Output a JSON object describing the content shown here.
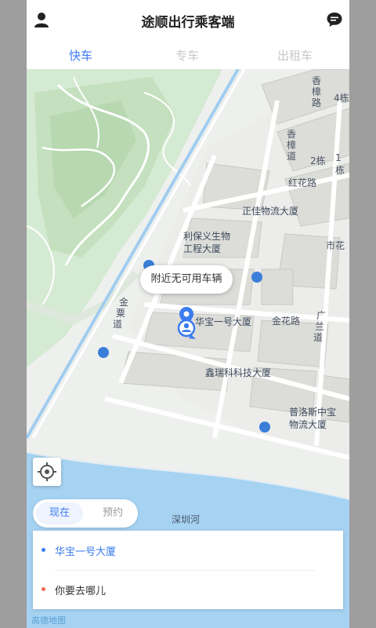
{
  "header": {
    "title": "途顺出行乘客端",
    "user_icon": "user-icon",
    "message_icon": "message-icon"
  },
  "tabs": [
    {
      "label": "快车",
      "active": true
    },
    {
      "label": "专车",
      "active": false
    },
    {
      "label": "出租车",
      "active": false
    }
  ],
  "map": {
    "bubble_text": "附近无可用车辆",
    "labels": {
      "zhengjia": "正佳物流大厦",
      "libaoyi_line1": "利保义生物",
      "libaoyi_line2": "工程大厦",
      "huabao": "华宝一号大厦",
      "xinrui": "鑫瑞科科技大厦",
      "puluosi_line1": "普洛斯中宝",
      "puluosi_line2": "物流大厦",
      "honghua_road": "红花路",
      "jinhua_road": "金花路",
      "shenzhen_river": "深圳河",
      "xiangzhang_1": "香",
      "xiangzhang_2": "樟",
      "xiangzhang_3": "路",
      "xiangzhang_b1": "香",
      "xiangzhang_b2": "樟",
      "xiangzhang_b3": "道",
      "jinguo_1": "金",
      "jinguo_2": "粟",
      "jinguo_3": "道",
      "guangsan_1": "广",
      "guangsan_2": "兰",
      "guangsan_3": "道",
      "shihua": "市花",
      "bldg_4": "4栋",
      "bldg_2": "2栋",
      "bldg_1": "1栋"
    },
    "watermark": "高德地图"
  },
  "ride_mode": {
    "now": "现在",
    "book": "预约"
  },
  "route": {
    "origin": "华宝一号大厦",
    "destination_placeholder": "你要去哪儿",
    "origin_color": "#3b7cf0",
    "destination_color": "#f06a5a"
  },
  "colors": {
    "accent": "#3b7cf0",
    "inactive_tab": "#c8c8c8"
  }
}
